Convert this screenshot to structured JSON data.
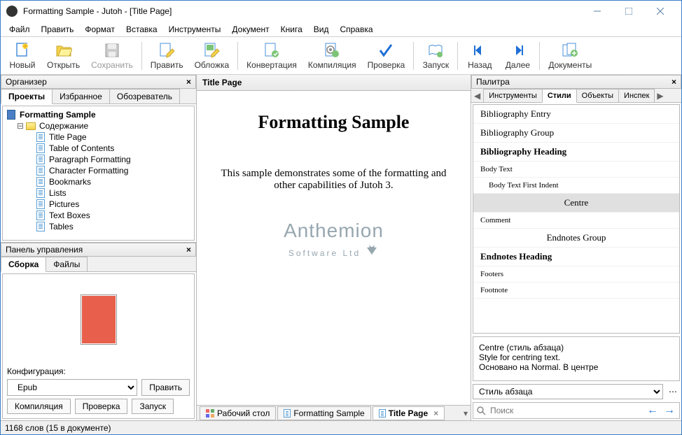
{
  "window": {
    "title": "Formatting Sample - Jutoh - [Title Page]"
  },
  "menu": [
    "Файл",
    "Править",
    "Формат",
    "Вставка",
    "Инструменты",
    "Документ",
    "Книга",
    "Вид",
    "Справка"
  ],
  "toolbar": {
    "new": "Новый",
    "open": "Открыть",
    "save": "Сохранить",
    "edit": "Править",
    "cover": "Обложка",
    "convert": "Конвертация",
    "compile": "Компиляция",
    "check": "Проверка",
    "launch": "Запуск",
    "back": "Назад",
    "forward": "Далее",
    "docs": "Документы"
  },
  "organizer": {
    "title": "Организер",
    "tabs": {
      "projects": "Проекты",
      "favorites": "Избранное",
      "browser": "Обозреватель"
    },
    "root": "Formatting Sample",
    "contents": "Содержание",
    "items": [
      "Title Page",
      "Table of Contents",
      "Paragraph Formatting",
      "Character Formatting",
      "Bookmarks",
      "Lists",
      "Pictures",
      "Text Boxes",
      "Tables"
    ]
  },
  "controlPanel": {
    "title": "Панель управления",
    "tabs": {
      "build": "Сборка",
      "files": "Файлы"
    },
    "configLabel": "Конфигурация:",
    "configValue": "Epub",
    "edit": "Править",
    "compile": "Компиляция",
    "check": "Проверка",
    "launch": "Запуск"
  },
  "document": {
    "tabTitle": "Title Page",
    "heading": "Formatting Sample",
    "body": "This sample demonstrates some of the formatting and other capabilities of Jutoh 3.",
    "logo1": "Anthemion",
    "logo2": "Software Ltd"
  },
  "bottomTabs": {
    "desktop": "Рабочий стол",
    "proj": "Formatting Sample",
    "page": "Title Page"
  },
  "palette": {
    "title": "Палитра",
    "tabs": {
      "tools": "Инструменты",
      "styles": "Стили",
      "objects": "Объекты",
      "inspect": "Инспек"
    },
    "styles": [
      "Bibliography Entry",
      "Bibliography Group",
      "Bibliography Heading",
      "Body Text",
      "Body Text First Indent",
      "Centre",
      "Comment",
      "Endnotes Group",
      "Endnotes Heading",
      "Footers",
      "Footnote"
    ],
    "desc": {
      "title": "Centre (стиль абзаца)",
      "line1": "Style for centring text.",
      "line2": "Основано на Normal. В центре"
    },
    "typeSelect": "Стиль абзаца",
    "searchPlaceholder": "Поиск"
  },
  "status": "1168 слов (15 в документе)"
}
